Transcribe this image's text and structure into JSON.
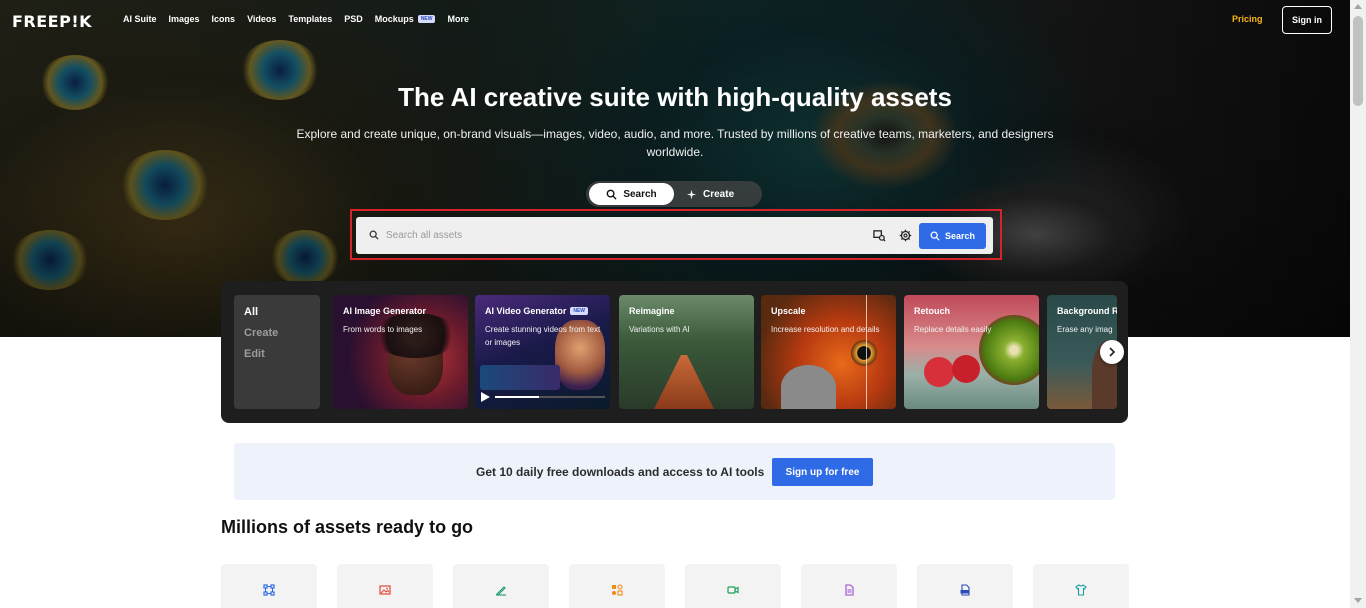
{
  "nav": {
    "logo": "FREEP!K",
    "links": [
      "AI Suite",
      "Images",
      "Icons",
      "Videos",
      "Templates",
      "PSD",
      "Mockups",
      "More"
    ],
    "mockups_badge": "NEW",
    "pricing": "Pricing",
    "signin": "Sign in"
  },
  "hero": {
    "title": "The AI creative suite with high-quality assets",
    "subtitle": "Explore and create unique, on-brand visuals—images, video, audio, and more. Trusted by millions of creative teams, marketers, and designers worldwide.",
    "toggle_search": "Search",
    "toggle_create": "Create",
    "search_placeholder": "Search all assets",
    "search_button": "Search"
  },
  "tools": {
    "modes": [
      "All",
      "Create",
      "Edit"
    ],
    "cards": [
      {
        "title": "AI Image Generator",
        "desc": "From words to images",
        "badge": ""
      },
      {
        "title": "AI Video Generator",
        "desc": "Create stunning videos from text or images",
        "badge": "NEW"
      },
      {
        "title": "Reimagine",
        "desc": "Variations with AI",
        "badge": ""
      },
      {
        "title": "Upscale",
        "desc": "Increase resolution and details",
        "badge": ""
      },
      {
        "title": "Retouch",
        "desc": "Replace details easily",
        "badge": ""
      },
      {
        "title": "Background R",
        "desc": "Erase any imag",
        "badge": ""
      }
    ]
  },
  "banner": {
    "text": "Get 10 daily free downloads and access to AI tools",
    "button": "Sign up for free"
  },
  "assets": {
    "title": "Millions of assets ready to go",
    "tile_icons": [
      "vector-icon",
      "image-icon",
      "brush-icon",
      "shapes-icon",
      "video-icon",
      "document-icon",
      "psd-icon",
      "mockup-shirt-icon"
    ]
  },
  "colors": {
    "accent": "#2f6be6",
    "pricing": "#f8b416",
    "search_highlight": "#d8222a"
  }
}
